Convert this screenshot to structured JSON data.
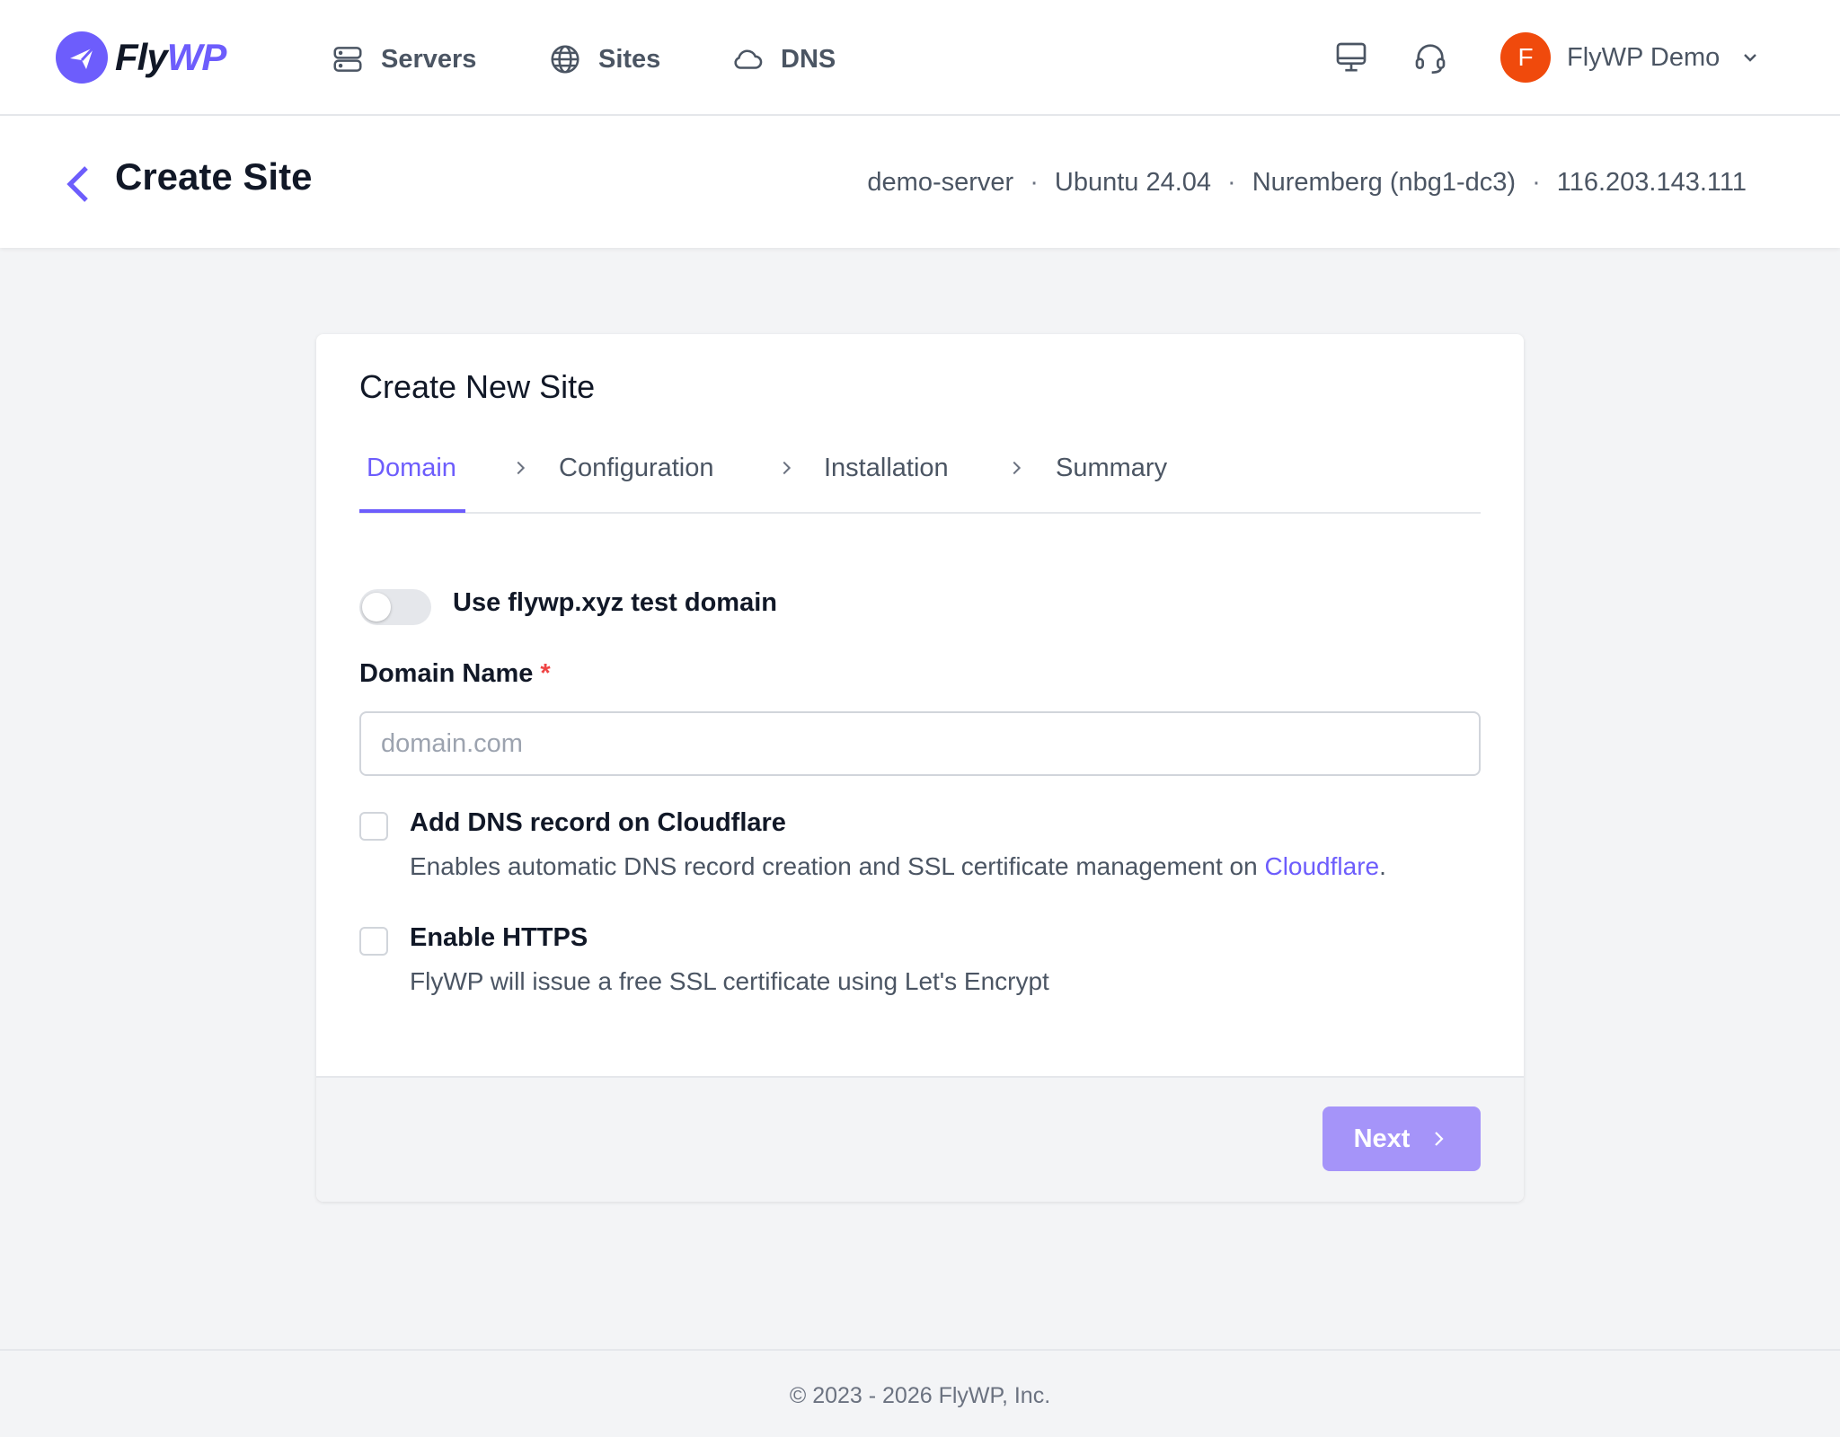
{
  "brand": {
    "name_primary": "Fly",
    "name_accent": "WP",
    "accent_color": "#6d5dfc"
  },
  "nav": {
    "links": [
      {
        "label": "Servers",
        "icon": "server-icon"
      },
      {
        "label": "Sites",
        "icon": "globe-icon"
      },
      {
        "label": "DNS",
        "icon": "cloud-icon"
      }
    ],
    "icons": [
      "monitor-icon",
      "headset-icon"
    ],
    "user": {
      "initial": "F",
      "name": "FlyWP Demo",
      "avatar_color": "#f04a0c"
    }
  },
  "header": {
    "title": "Create Site",
    "server": {
      "name": "demo-server",
      "os": "Ubuntu 24.04",
      "region": "Nuremberg (nbg1-dc3)",
      "ip": "116.203.143.111",
      "separator": "·"
    }
  },
  "card": {
    "title": "Create New Site",
    "steps": [
      {
        "label": "Domain",
        "active": true
      },
      {
        "label": "Configuration",
        "active": false
      },
      {
        "label": "Installation",
        "active": false
      },
      {
        "label": "Summary",
        "active": false
      }
    ],
    "test_domain_toggle": {
      "label": "Use flywp.xyz test domain",
      "on": false
    },
    "domain_field": {
      "label": "Domain Name",
      "required_mark": "*",
      "placeholder": "domain.com",
      "value": ""
    },
    "cloudflare": {
      "title": "Add DNS record on Cloudflare",
      "desc": "Enables automatic DNS record creation and SSL certificate management on",
      "link": "Cloudflare",
      "desc_end": ".",
      "checked": false
    },
    "https": {
      "title": "Enable HTTPS",
      "desc": "FlyWP will issue a free SSL certificate using Let's Encrypt",
      "checked": false
    },
    "next_label": "Next"
  },
  "footer": {
    "copyright": "© 2023 - 2026 FlyWP, Inc."
  }
}
